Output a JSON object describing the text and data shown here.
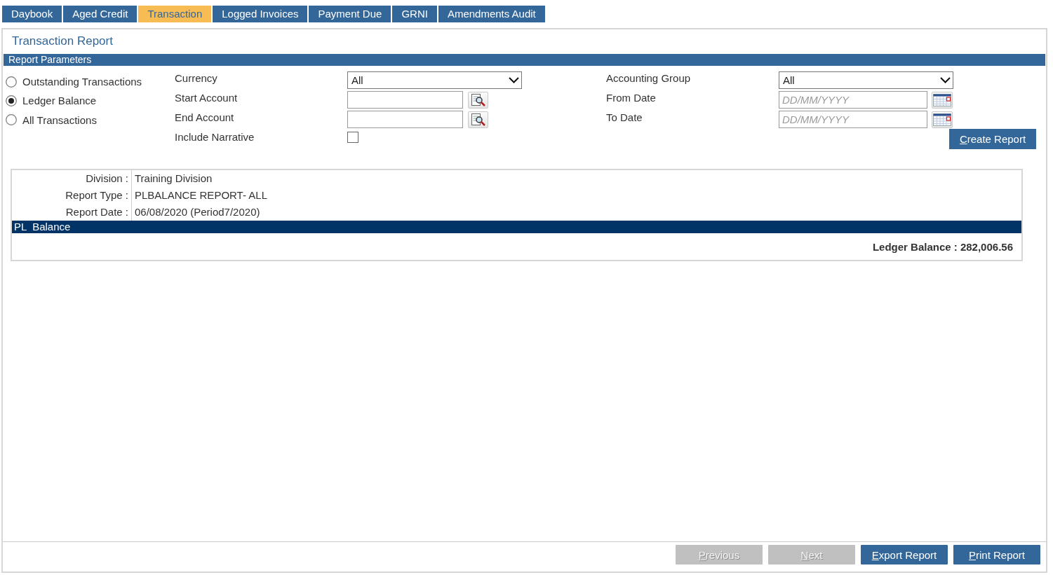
{
  "tabs": [
    {
      "label": "Daybook",
      "selected": false
    },
    {
      "label": "Aged Credit",
      "selected": false
    },
    {
      "label": "Transaction",
      "selected": true
    },
    {
      "label": "Logged Invoices",
      "selected": false
    },
    {
      "label": "Payment Due",
      "selected": false
    },
    {
      "label": "GRNI",
      "selected": false
    },
    {
      "label": "Amendments Audit",
      "selected": false
    }
  ],
  "report": {
    "title": "Transaction Report",
    "parameters": {
      "heading": "Report Parameters",
      "report_options": [
        {
          "label": "Outstanding Transactions",
          "selected": false
        },
        {
          "label": "Ledger Balance",
          "selected": true
        },
        {
          "label": "All Transactions",
          "selected": false
        }
      ],
      "fields_left": [
        {
          "kind": "select",
          "label": "Currency",
          "value": "All"
        },
        {
          "kind": "lookup",
          "label": "Start Account"
        },
        {
          "kind": "lookup",
          "label": "End Account"
        },
        {
          "kind": "checkbox",
          "label": "Include Narrative",
          "checked": false
        }
      ],
      "fields_right": [
        {
          "kind": "select",
          "label": "Accounting Group",
          "value": "All"
        },
        {
          "kind": "date",
          "label": "From Date",
          "placeholder": "DD/MM/YYYY"
        },
        {
          "kind": "date",
          "label": "To Date",
          "placeholder": "DD/MM/YYYY"
        }
      ],
      "create_button": {
        "label": "Create Report",
        "mnemonic": true
      }
    },
    "result": {
      "info": [
        {
          "label": "Division :",
          "value": "Training Division"
        },
        {
          "label": "Report Type :",
          "value": "PLBALANCE REPORT- ALL"
        },
        {
          "label": "Report Date :",
          "value": "06/08/2020 (Period7/2020)"
        }
      ],
      "section_header": "PL  Balance",
      "total": "Ledger Balance : 282,006.56"
    }
  },
  "footer_buttons": [
    {
      "label": "Previous",
      "disabled": true,
      "mnemonic": true
    },
    {
      "label": "Next",
      "disabled": true,
      "mnemonic": true
    },
    {
      "label": "Export Report",
      "disabled": false,
      "mnemonic": true
    },
    {
      "label": "Print Report",
      "disabled": false,
      "mnemonic": true
    }
  ]
}
